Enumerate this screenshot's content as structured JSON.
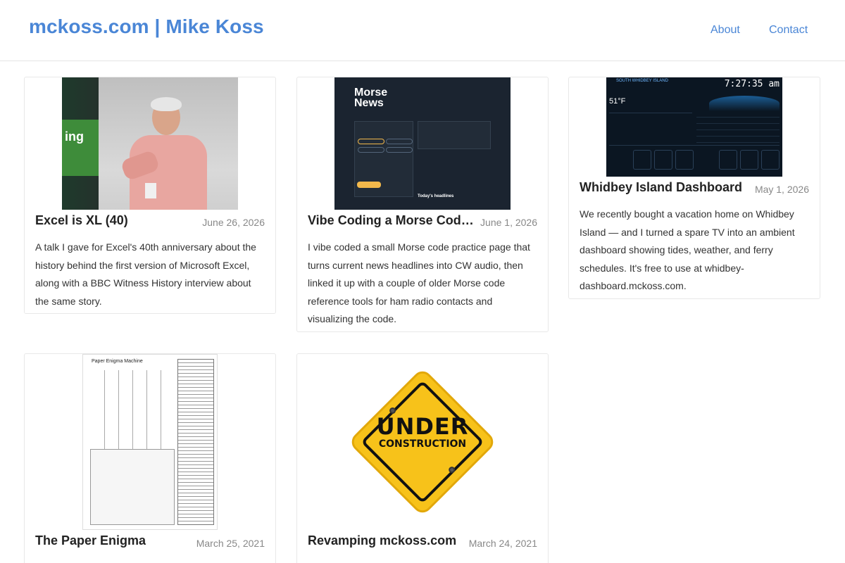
{
  "header": {
    "site_title": "mckoss.com | Mike Koss",
    "nav": [
      {
        "label": "About"
      },
      {
        "label": "Contact"
      }
    ]
  },
  "colors": {
    "link": "#4a86d6",
    "date": "#888888",
    "border": "#e8e8e8"
  },
  "posts": [
    {
      "title": "Excel is XL (40)",
      "date": "June 26, 2026",
      "excerpt": "A talk I gave for Excel's 40th anniversary about the history behind the first version of Microsoft Excel, along with a BBC Witness History interview about the same story.",
      "image": "speaker-photo"
    },
    {
      "title": "Vibe Coding a Morse Code ...",
      "date": "June 1, 2026",
      "excerpt": "I vibe coded a small Morse code practice page that turns current news headlines into CW audio, then linked it up with a couple of older Morse code reference tools for ham radio contacts and visualizing the code.",
      "image": "morse-news-screenshot",
      "thumb": {
        "title_line1": "Morse",
        "title_line2": "News",
        "headlines": "Today's headlines"
      }
    },
    {
      "title": "Whidbey Island Dashboard",
      "date": "May 1, 2026",
      "excerpt": "We recently bought a vacation home on Whidbey Island — and I turned a spare TV into an ambient dashboard showing tides, weather, and ferry schedules. It's free to use at whidbey-dashboard.mckoss.com.",
      "image": "dashboard-screenshot",
      "thumb": {
        "clock": "7:27:35 am",
        "banner": "SOUTH WHIDBEY ISLAND",
        "temp": "51°F"
      }
    },
    {
      "title": "The Paper Enigma",
      "date": "March 25, 2021",
      "image": "paper-enigma-sheet",
      "thumb": {
        "heading": "Paper Enigma Machine"
      }
    },
    {
      "title": "Revamping mckoss.com",
      "date": "March 24, 2021",
      "image": "under-construction-sign",
      "thumb": {
        "line1": "UNDER",
        "line2": "CONSTRUCTION"
      }
    }
  ]
}
